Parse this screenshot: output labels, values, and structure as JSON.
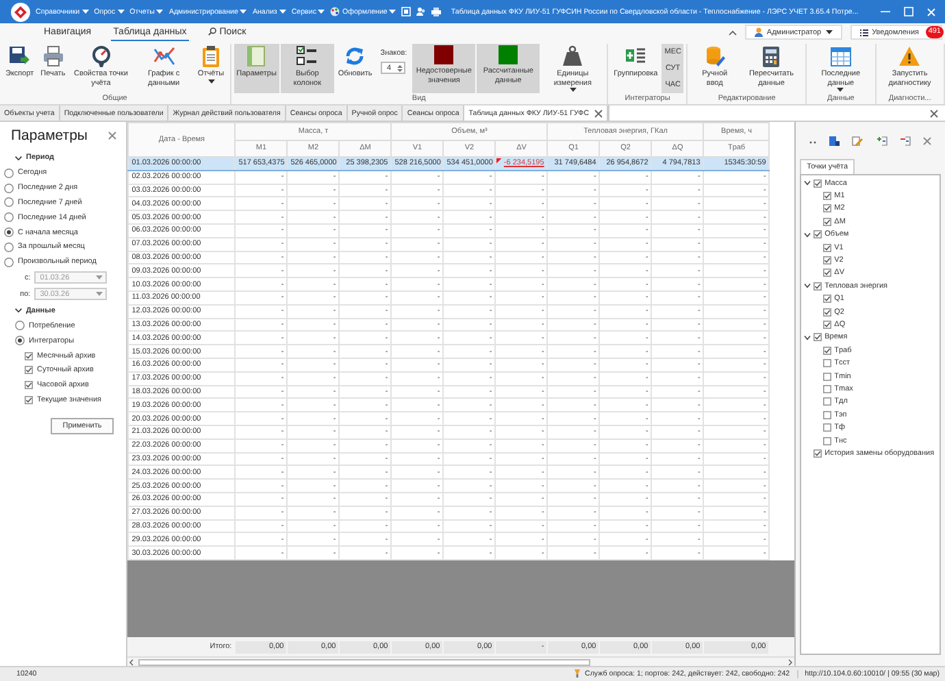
{
  "titlebar": {
    "menus": [
      {
        "label": "Справочники",
        "kind": "menu"
      },
      {
        "label": "Опрос",
        "kind": "menu"
      },
      {
        "label": "Отчеты",
        "kind": "menu"
      },
      {
        "label": "Администрирование",
        "kind": "menu"
      },
      {
        "label": "Анализ",
        "kind": "menu"
      },
      {
        "label": "Сервис",
        "kind": "menu"
      },
      {
        "label": "Оформление",
        "kind": "icon-menu"
      }
    ],
    "title": "Таблица данных ФКУ ЛИУ-51 ГУФСИН России по Свердловской области - Теплоснабжение - ЛЭРС УЧЕТ 3.65.4 Потре..."
  },
  "ribbon_tabs": [
    {
      "label": "Навигация",
      "selected": false,
      "kind": "tab"
    },
    {
      "label": "Таблица данных",
      "selected": true,
      "kind": "tab"
    },
    {
      "label": "Поиск",
      "selected": false,
      "kind": "search"
    }
  ],
  "user_menu": {
    "label": "Администратор"
  },
  "notifications": {
    "label": "Уведомления",
    "badge": "491"
  },
  "ribbon": {
    "groups": [
      {
        "label": "Общие",
        "items": [
          {
            "kind": "button",
            "label": "Экспорт",
            "on": false,
            "dropdown": false
          },
          {
            "kind": "button",
            "label": "Печать",
            "on": false,
            "dropdown": false
          },
          {
            "kind": "button",
            "label": "Свойства точки учёта",
            "on": false,
            "dropdown": false
          },
          {
            "kind": "button",
            "label": "График с данными",
            "on": false,
            "dropdown": false
          },
          {
            "kind": "button",
            "label": "Отчёты",
            "on": false,
            "dropdown": true
          }
        ]
      },
      {
        "label": "Вид",
        "items": [
          {
            "kind": "button",
            "label": "Параметры",
            "on": true,
            "dropdown": false
          },
          {
            "kind": "button",
            "label": "Выбор колонок",
            "on": true,
            "dropdown": false
          },
          {
            "kind": "button",
            "label": "Обновить",
            "on": false,
            "dropdown": false
          },
          {
            "kind": "spinner",
            "label": "Знаков:",
            "value": "4"
          },
          {
            "kind": "swatch",
            "label": "Недостоверные значения",
            "color": "#800000",
            "on": true
          },
          {
            "kind": "swatch",
            "label": "Рассчитанные данные",
            "color": "#008000",
            "on": true
          },
          {
            "kind": "button",
            "label": "Единицы измерения",
            "on": false,
            "dropdown": true
          }
        ]
      },
      {
        "label": "Интеграторы",
        "items": [
          {
            "kind": "button",
            "label": "Группировка",
            "on": false,
            "dropdown": false
          },
          {
            "kind": "stack",
            "labels": [
              "МЕС",
              "СУТ",
              "ЧАС"
            ]
          }
        ]
      },
      {
        "label": "Редактирование",
        "items": [
          {
            "kind": "button",
            "label": "Ручной ввод",
            "on": false,
            "dropdown": false
          },
          {
            "kind": "button",
            "label": "Пересчитать данные",
            "on": false,
            "dropdown": false
          }
        ]
      },
      {
        "label": "Данные",
        "items": [
          {
            "kind": "button",
            "label": "Последние данные",
            "on": false,
            "dropdown": true
          }
        ]
      },
      {
        "label": "Диагности...",
        "items": [
          {
            "kind": "button",
            "label": "Запустить диагностику",
            "on": false,
            "dropdown": false
          }
        ]
      }
    ]
  },
  "document_tabs": [
    {
      "label": "Объекты учета",
      "selected": false,
      "closable": false
    },
    {
      "label": "Подключенные пользователи",
      "selected": false,
      "closable": false
    },
    {
      "label": "Журнал действий пользователя",
      "selected": false,
      "closable": false
    },
    {
      "label": "Сеансы опроса",
      "selected": false,
      "closable": false
    },
    {
      "label": "Ручной опрос",
      "selected": false,
      "closable": false
    },
    {
      "label": "Сеансы опроса",
      "selected": false,
      "closable": false
    },
    {
      "label": "Таблица данных ФКУ ЛИУ-51 ГУФС",
      "selected": true,
      "closable": true
    }
  ],
  "parameters": {
    "title": "Параметры",
    "period": {
      "title": "Период",
      "expanded": true,
      "options": [
        {
          "label": "Сегодня",
          "selected": false
        },
        {
          "label": "Последние 2 дня",
          "selected": false
        },
        {
          "label": "Последние 7 дней",
          "selected": false
        },
        {
          "label": "Последние 14 дней",
          "selected": false
        },
        {
          "label": "С начала месяца",
          "selected": true
        },
        {
          "label": "За прошлый месяц",
          "selected": false
        },
        {
          "label": "Произвольный период",
          "selected": false
        }
      ],
      "from": {
        "label": "с:",
        "value": "01.03.26",
        "disabled": true
      },
      "to": {
        "label": "по:",
        "value": "30.03.26",
        "disabled": true
      }
    },
    "data": {
      "title": "Данные",
      "expanded": true,
      "options": [
        {
          "label": "Потребление",
          "selected": false
        },
        {
          "label": "Интеграторы",
          "selected": true
        }
      ],
      "archives": [
        {
          "label": "Месячный архив",
          "checked": true
        },
        {
          "label": "Суточный архив",
          "checked": true
        },
        {
          "label": "Часовой архив",
          "checked": true
        },
        {
          "label": "Текущие значения",
          "checked": true
        }
      ]
    },
    "apply_button": "Применить"
  },
  "table": {
    "date_column": "Дата - Время",
    "groups": [
      {
        "label": "Масса, т",
        "columns": [
          "M1",
          "M2",
          "ΔM"
        ]
      },
      {
        "label": "Объем, м³",
        "columns": [
          "V1",
          "V2",
          "ΔV"
        ]
      },
      {
        "label": "Тепловая энергия, ГКал",
        "columns": [
          "Q1",
          "Q2",
          "ΔQ"
        ]
      },
      {
        "label": "Время, ч",
        "columns": [
          "Tраб"
        ]
      }
    ],
    "rows": [
      {
        "date": "01.03.2026 00:00:00",
        "selected": true,
        "cells": [
          {
            "text": "517 653,4375",
            "invalid": false
          },
          {
            "text": "526 465,0000",
            "invalid": false
          },
          {
            "text": "25 398,2305",
            "invalid": false
          },
          {
            "text": "528 216,5000",
            "invalid": false
          },
          {
            "text": "534 451,0000",
            "invalid": false
          },
          {
            "text": "-6 234,5195",
            "invalid": true
          },
          {
            "text": "31 749,6484",
            "invalid": false
          },
          {
            "text": "26 954,8672",
            "invalid": false
          },
          {
            "text": "4 794,7813",
            "invalid": false
          },
          {
            "text": "15345:30:59",
            "invalid": false
          }
        ]
      },
      {
        "date": "02.03.2026 00:00:00",
        "selected": false,
        "cells": [
          "-",
          "-",
          "-",
          "-",
          "-",
          "-",
          "-",
          "-",
          "-",
          "-"
        ]
      },
      {
        "date": "03.03.2026 00:00:00",
        "selected": false,
        "cells": [
          "-",
          "-",
          "-",
          "-",
          "-",
          "-",
          "-",
          "-",
          "-",
          "-"
        ]
      },
      {
        "date": "04.03.2026 00:00:00",
        "selected": false,
        "cells": [
          "-",
          "-",
          "-",
          "-",
          "-",
          "-",
          "-",
          "-",
          "-",
          "-"
        ]
      },
      {
        "date": "05.03.2026 00:00:00",
        "selected": false,
        "cells": [
          "-",
          "-",
          "-",
          "-",
          "-",
          "-",
          "-",
          "-",
          "-",
          "-"
        ]
      },
      {
        "date": "06.03.2026 00:00:00",
        "selected": false,
        "cells": [
          "-",
          "-",
          "-",
          "-",
          "-",
          "-",
          "-",
          "-",
          "-",
          "-"
        ]
      },
      {
        "date": "07.03.2026 00:00:00",
        "selected": false,
        "cells": [
          "-",
          "-",
          "-",
          "-",
          "-",
          "-",
          "-",
          "-",
          "-",
          "-"
        ]
      },
      {
        "date": "08.03.2026 00:00:00",
        "selected": false,
        "cells": [
          "-",
          "-",
          "-",
          "-",
          "-",
          "-",
          "-",
          "-",
          "-",
          "-"
        ]
      },
      {
        "date": "09.03.2026 00:00:00",
        "selected": false,
        "cells": [
          "-",
          "-",
          "-",
          "-",
          "-",
          "-",
          "-",
          "-",
          "-",
          "-"
        ]
      },
      {
        "date": "10.03.2026 00:00:00",
        "selected": false,
        "cells": [
          "-",
          "-",
          "-",
          "-",
          "-",
          "-",
          "-",
          "-",
          "-",
          "-"
        ]
      },
      {
        "date": "11.03.2026 00:00:00",
        "selected": false,
        "cells": [
          "-",
          "-",
          "-",
          "-",
          "-",
          "-",
          "-",
          "-",
          "-",
          "-"
        ]
      },
      {
        "date": "12.03.2026 00:00:00",
        "selected": false,
        "cells": [
          "-",
          "-",
          "-",
          "-",
          "-",
          "-",
          "-",
          "-",
          "-",
          "-"
        ]
      },
      {
        "date": "13.03.2026 00:00:00",
        "selected": false,
        "cells": [
          "-",
          "-",
          "-",
          "-",
          "-",
          "-",
          "-",
          "-",
          "-",
          "-"
        ]
      },
      {
        "date": "14.03.2026 00:00:00",
        "selected": false,
        "cells": [
          "-",
          "-",
          "-",
          "-",
          "-",
          "-",
          "-",
          "-",
          "-",
          "-"
        ]
      },
      {
        "date": "15.03.2026 00:00:00",
        "selected": false,
        "cells": [
          "-",
          "-",
          "-",
          "-",
          "-",
          "-",
          "-",
          "-",
          "-",
          "-"
        ]
      },
      {
        "date": "16.03.2026 00:00:00",
        "selected": false,
        "cells": [
          "-",
          "-",
          "-",
          "-",
          "-",
          "-",
          "-",
          "-",
          "-",
          "-"
        ]
      },
      {
        "date": "17.03.2026 00:00:00",
        "selected": false,
        "cells": [
          "-",
          "-",
          "-",
          "-",
          "-",
          "-",
          "-",
          "-",
          "-",
          "-"
        ]
      },
      {
        "date": "18.03.2026 00:00:00",
        "selected": false,
        "cells": [
          "-",
          "-",
          "-",
          "-",
          "-",
          "-",
          "-",
          "-",
          "-",
          "-"
        ]
      },
      {
        "date": "19.03.2026 00:00:00",
        "selected": false,
        "cells": [
          "-",
          "-",
          "-",
          "-",
          "-",
          "-",
          "-",
          "-",
          "-",
          "-"
        ]
      },
      {
        "date": "20.03.2026 00:00:00",
        "selected": false,
        "cells": [
          "-",
          "-",
          "-",
          "-",
          "-",
          "-",
          "-",
          "-",
          "-",
          "-"
        ]
      },
      {
        "date": "21.03.2026 00:00:00",
        "selected": false,
        "cells": [
          "-",
          "-",
          "-",
          "-",
          "-",
          "-",
          "-",
          "-",
          "-",
          "-"
        ]
      },
      {
        "date": "22.03.2026 00:00:00",
        "selected": false,
        "cells": [
          "-",
          "-",
          "-",
          "-",
          "-",
          "-",
          "-",
          "-",
          "-",
          "-"
        ]
      },
      {
        "date": "23.03.2026 00:00:00",
        "selected": false,
        "cells": [
          "-",
          "-",
          "-",
          "-",
          "-",
          "-",
          "-",
          "-",
          "-",
          "-"
        ]
      },
      {
        "date": "24.03.2026 00:00:00",
        "selected": false,
        "cells": [
          "-",
          "-",
          "-",
          "-",
          "-",
          "-",
          "-",
          "-",
          "-",
          "-"
        ]
      },
      {
        "date": "25.03.2026 00:00:00",
        "selected": false,
        "cells": [
          "-",
          "-",
          "-",
          "-",
          "-",
          "-",
          "-",
          "-",
          "-",
          "-"
        ]
      },
      {
        "date": "26.03.2026 00:00:00",
        "selected": false,
        "cells": [
          "-",
          "-",
          "-",
          "-",
          "-",
          "-",
          "-",
          "-",
          "-",
          "-"
        ]
      },
      {
        "date": "27.03.2026 00:00:00",
        "selected": false,
        "cells": [
          "-",
          "-",
          "-",
          "-",
          "-",
          "-",
          "-",
          "-",
          "-",
          "-"
        ]
      },
      {
        "date": "28.03.2026 00:00:00",
        "selected": false,
        "cells": [
          "-",
          "-",
          "-",
          "-",
          "-",
          "-",
          "-",
          "-",
          "-",
          "-"
        ]
      },
      {
        "date": "29.03.2026 00:00:00",
        "selected": false,
        "cells": [
          "-",
          "-",
          "-",
          "-",
          "-",
          "-",
          "-",
          "-",
          "-",
          "-"
        ]
      },
      {
        "date": "30.03.2026 00:00:00",
        "selected": false,
        "cells": [
          "-",
          "-",
          "-",
          "-",
          "-",
          "-",
          "-",
          "-",
          "-",
          "-"
        ]
      }
    ],
    "totals": {
      "label": "Итого:",
      "values": [
        "0,00",
        "0,00",
        "0,00",
        "0,00",
        "0,00",
        "-",
        "0,00",
        "0,00",
        "0,00",
        "0,00"
      ]
    }
  },
  "points_panel": {
    "tabs": [
      {
        "label": "Точки учёта",
        "selected": true
      }
    ],
    "tree": [
      {
        "label": "Масса",
        "checked": true,
        "expanded": true,
        "children": [
          {
            "label": "M1",
            "checked": true
          },
          {
            "label": "M2",
            "checked": true
          },
          {
            "label": "ΔM",
            "checked": true
          }
        ]
      },
      {
        "label": "Объем",
        "checked": true,
        "expanded": true,
        "children": [
          {
            "label": "V1",
            "checked": true
          },
          {
            "label": "V2",
            "checked": true
          },
          {
            "label": "ΔV",
            "checked": true
          }
        ]
      },
      {
        "label": "Тепловая энергия",
        "checked": true,
        "expanded": true,
        "children": [
          {
            "label": "Q1",
            "checked": true
          },
          {
            "label": "Q2",
            "checked": true
          },
          {
            "label": "ΔQ",
            "checked": true
          }
        ]
      },
      {
        "label": "Время",
        "checked": true,
        "expanded": true,
        "children": [
          {
            "label": "Tраб",
            "checked": true
          },
          {
            "label": "Tсст",
            "checked": false
          },
          {
            "label": "Tmin",
            "checked": false
          },
          {
            "label": "Tmax",
            "checked": false
          },
          {
            "label": "Tдл",
            "checked": false
          },
          {
            "label": "Tэп",
            "checked": false
          },
          {
            "label": "Tф",
            "checked": false
          },
          {
            "label": "Tнс",
            "checked": false
          }
        ]
      },
      {
        "label": "История замены оборудования",
        "checked": true
      }
    ]
  },
  "status_bar": {
    "count": "10240",
    "services": "Служб опроса: 1; портов: 242, действует: 242, свободно: 242",
    "server": "http://10.104.0.60:10010/ | 09:55 (30 мар)"
  }
}
